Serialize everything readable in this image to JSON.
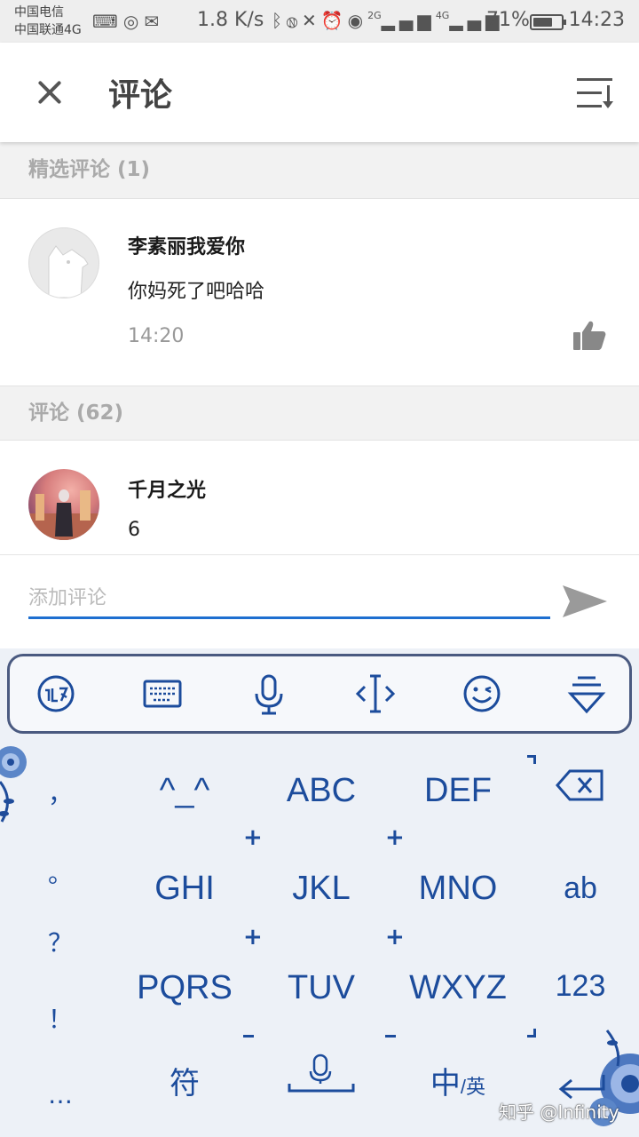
{
  "status_bar": {
    "carrier_1": "中国电信",
    "carrier_2": "中国联通4G",
    "network_speed": "1.8 K/s",
    "network_labels": [
      "2G",
      "4G"
    ],
    "battery_percent": "71%",
    "battery_level": 0.71,
    "time": "14:23",
    "icons": [
      "keyboard-icon",
      "netease-music-icon",
      "wechat-icon",
      "bluetooth-icon",
      "nfc-icon",
      "mute-icon",
      "alarm-icon",
      "eye-comfort-icon",
      "signal-icon",
      "signal-icon",
      "battery-icon"
    ]
  },
  "header": {
    "title": "评论",
    "close_icon": "close-icon",
    "sort_icon": "sort-icon"
  },
  "featured_section": {
    "label": "精选评论 (1)"
  },
  "featured_comments": [
    {
      "username": "李素丽我爱你",
      "content": "你妈死了吧哈哈",
      "time": "14:20",
      "avatar": "default-avatar",
      "like_icon": "thumbs-up-icon"
    }
  ],
  "comments_section": {
    "label": "评论 (62)"
  },
  "comments": [
    {
      "username": "千月之光",
      "content": "6",
      "avatar": "photo-avatar"
    }
  ],
  "input_bar": {
    "placeholder": "添加评论",
    "send_icon": "send-icon"
  },
  "keyboard": {
    "toolbar_icons": [
      "ifly-logo-icon",
      "keyboard-icon",
      "microphone-icon",
      "cursor-icon",
      "emoji-icon",
      "collapse-keyboard-icon"
    ],
    "side_punctuation": [
      "，",
      "。",
      "？",
      "！",
      "…"
    ],
    "keys": [
      [
        "^_^",
        "ABC",
        "DEF"
      ],
      [
        "GHI",
        "JKL",
        "MNO"
      ],
      [
        "PQRS",
        "TUV",
        "WXYZ"
      ]
    ],
    "right_keys": [
      "ab",
      "123"
    ],
    "backspace_icon": "backspace-icon",
    "symbol_key": "符",
    "space_icon": "space-mic-icon",
    "lang_key_main": "中",
    "lang_key_sub": "英",
    "enter_icon": "enter-icon",
    "accent_color": "#1c4c9c",
    "background_color": "#edf1f7"
  },
  "watermark": "知乎 @Infinity"
}
